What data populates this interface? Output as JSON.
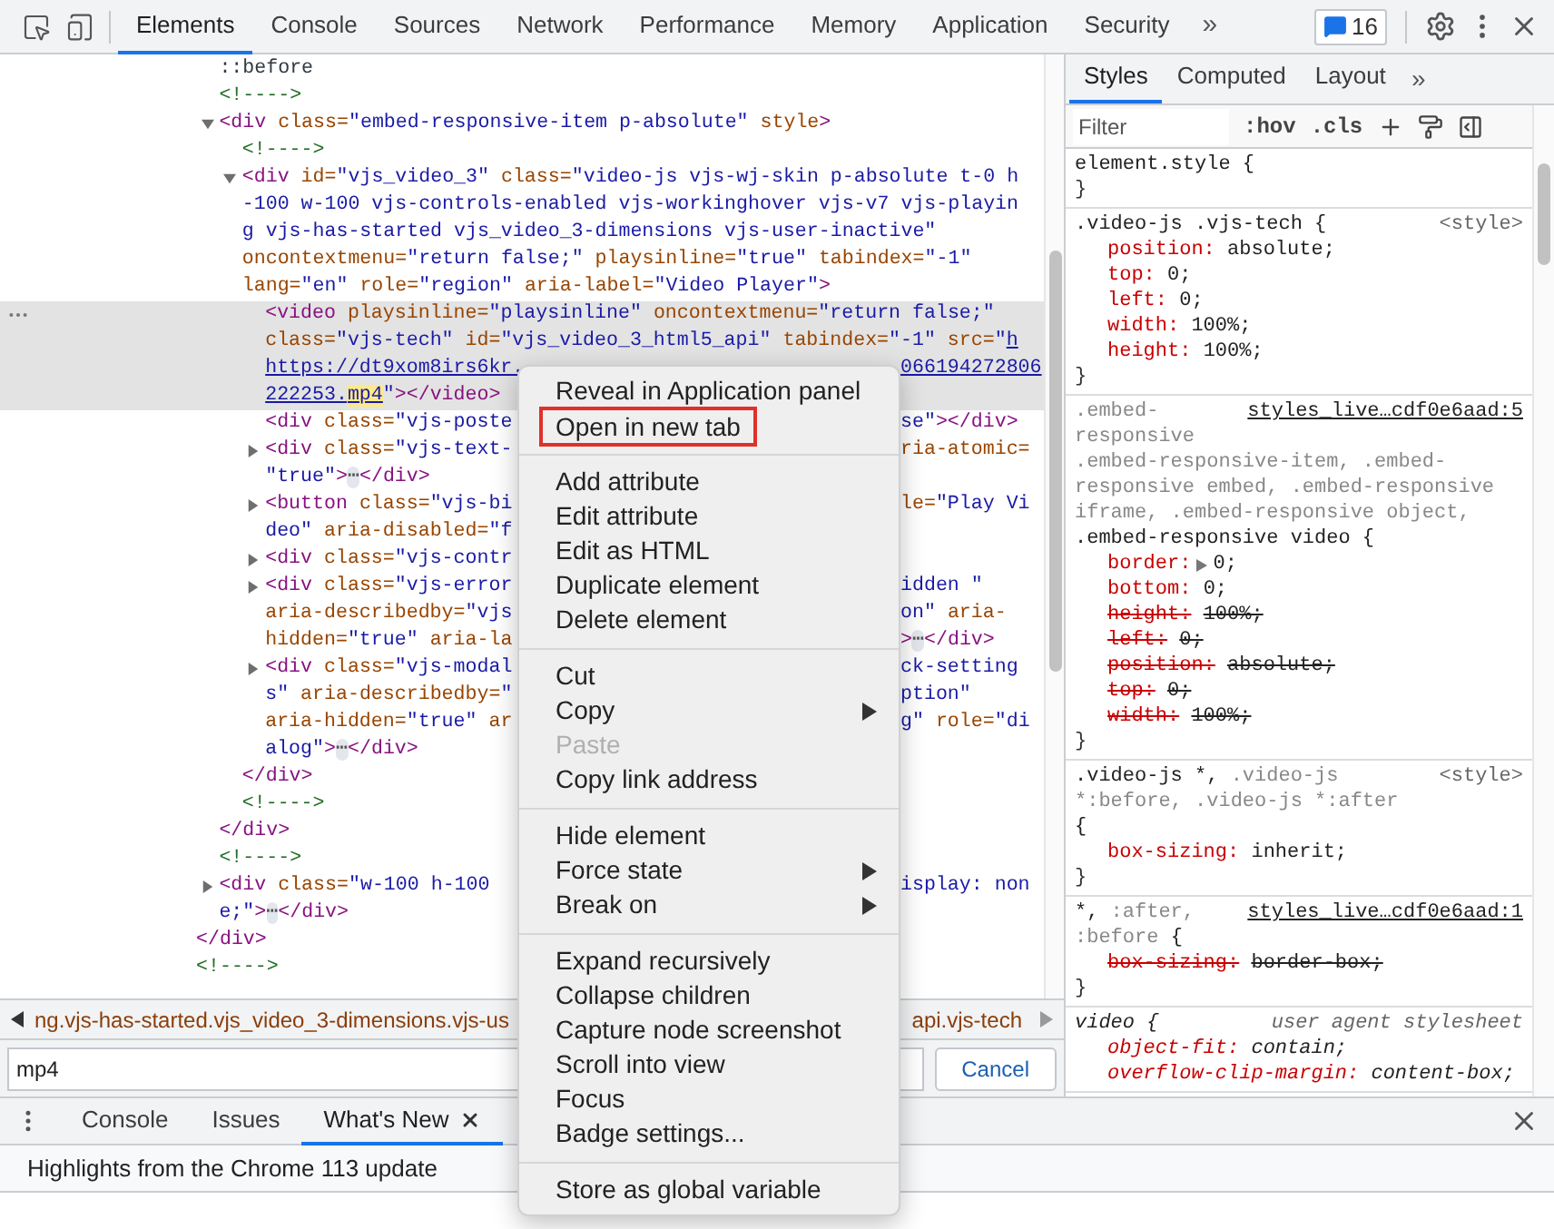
{
  "toolbar": {
    "tabs": [
      {
        "label": "Elements",
        "selected": true
      },
      {
        "label": "Console",
        "selected": false
      },
      {
        "label": "Sources",
        "selected": false
      },
      {
        "label": "Network",
        "selected": false
      },
      {
        "label": "Performance",
        "selected": false
      },
      {
        "label": "Memory",
        "selected": false
      },
      {
        "label": "Application",
        "selected": false
      },
      {
        "label": "Security",
        "selected": false
      }
    ],
    "more": "»",
    "issues_count": "16"
  },
  "elements": {
    "tree": [
      {
        "closing": "</div>",
        "children": [
          {
            "lines": [
              "::before"
            ],
            "selected": false
          },
          {
            "lines": [
              "<!---->"
            ],
            "selected": false
          },
          {
            "lines": [
              "<div class=\"embed-responsive-item p-absolute\" style>"
            ],
            "selected": false,
            "expanded": true,
            "closing": "</div>",
            "children": [
              {
                "lines": [
                  "<!---->"
                ],
                "selected": false
              },
              {
                "lines": [
                  "<div id=\"vjs_video_3\" class=\"video-js vjs-wj-skin p-absolute t-0 h",
                  "-100 w-100 vjs-controls-enabled vjs-workinghover vjs-v7 vjs-playin",
                  "g vjs-has-started vjs_video_3-dimensions vjs-user-inactive\"",
                  "oncontextmenu=\"return false;\" playsinline=\"true\" tabindex=\"-1\"",
                  "lang=\"en\" role=\"region\" aria-label=\"Video Player\">"
                ],
                "selected": false,
                "expanded": true,
                "closing": "</div>",
                "children": [
                  {
                    "lines": [
                      "<video playsinline=\"playsinline\" oncontextmenu=\"return false;\"",
                      {
                        "segments": [
                          {
                            "kind": "attr",
                            "text": "class="
                          },
                          {
                            "kind": "value",
                            "text": "\"vjs-tech\""
                          },
                          {
                            "kind": "attr",
                            "text": " id="
                          },
                          {
                            "kind": "value",
                            "text": "\"vjs_video_3_html5_api\""
                          },
                          {
                            "kind": "attr",
                            "text": " tabindex="
                          },
                          {
                            "kind": "value",
                            "text": "\"-1\""
                          },
                          {
                            "kind": "attr",
                            "text": " src="
                          },
                          {
                            "kind": "value",
                            "text": "\""
                          },
                          {
                            "kind": "link",
                            "text": "h"
                          }
                        ]
                      },
                      {
                        "segments": [
                          {
                            "kind": "link",
                            "text": "https://dt9xom8irs6kr."
                          }
                        ],
                        "right_segments": [
                          {
                            "kind": "link",
                            "text": "066194272806"
                          }
                        ]
                      },
                      {
                        "segments": [
                          {
                            "kind": "link",
                            "text": "222253."
                          },
                          {
                            "kind": "match",
                            "text": "mp4"
                          },
                          {
                            "kind": "value",
                            "text": "\""
                          },
                          {
                            "kind": "tag",
                            "text": "></video>"
                          }
                        ]
                      }
                    ],
                    "selected": true
                  },
                  {
                    "lines": [
                      {
                        "left": "<div class=\"vjs-poste",
                        "right": "se\"></div>",
                        "right_in_value": true
                      }
                    ],
                    "selected": false
                  },
                  {
                    "lines": [
                      {
                        "left": "<div class=\"vjs-text-",
                        "right": "ria-atomic=",
                        "right_in_value": false
                      },
                      "\"true\">⋯</div>"
                    ],
                    "selected": false,
                    "expanded": false
                  },
                  {
                    "lines": [
                      {
                        "left": "<button class=\"vjs-bi",
                        "right": "le=\"Play Vi",
                        "right_in_value": false
                      },
                      "deo\" aria-disabled=\"f"
                    ],
                    "selected": false,
                    "expanded": false
                  },
                  {
                    "lines": [
                      "<div class=\"vjs-contr"
                    ],
                    "selected": false,
                    "expanded": false
                  },
                  {
                    "lines": [
                      {
                        "left": "<div class=\"vjs-error",
                        "right": "idden \"",
                        "right_in_value": true
                      },
                      {
                        "left": "aria-describedby=\"vjs",
                        "right": "on\" aria-",
                        "right_in_value": true
                      },
                      {
                        "left": "hidden=\"true\" aria-la",
                        "right": ">⋯</div>",
                        "right_in_value": false
                      }
                    ],
                    "selected": false,
                    "expanded": false
                  },
                  {
                    "lines": [
                      {
                        "left": "<div class=\"vjs-modal",
                        "right": "ck-setting",
                        "right_in_value": true
                      },
                      {
                        "left": "s\" aria-describedby=\"",
                        "right": "ption\"",
                        "right_in_value": true
                      },
                      {
                        "left": "aria-hidden=\"true\" ar",
                        "right": "g\" role=\"di",
                        "right_in_value": true
                      },
                      "alog\">⋯</div>"
                    ],
                    "selected": false,
                    "expanded": false
                  }
                ]
              },
              {
                "lines": [
                  "<!---->"
                ],
                "selected": false
              }
            ]
          },
          {
            "lines": [
              "<!---->"
            ],
            "selected": false
          },
          {
            "lines": [
              {
                "left": "<div class=\"w-100 h-100 ",
                "right": "isplay: non",
                "right_in_value": true
              },
              "e;\">⋯</div>"
            ],
            "selected": false,
            "expanded": false
          }
        ]
      },
      {
        "lines": [
          "<!---->"
        ],
        "selected": false
      }
    ],
    "breadcrumbs": {
      "left": "ng.vjs-has-started.vjs_video_3-dimensions.vjs-us",
      "right": "api.vjs-tech"
    },
    "search": {
      "value": "mp4",
      "cancel": "Cancel"
    }
  },
  "styles": {
    "tabs": [
      {
        "label": "Styles",
        "selected": true
      },
      {
        "label": "Computed",
        "selected": false
      },
      {
        "label": "Layout",
        "selected": false
      }
    ],
    "more": "»",
    "filter": {
      "placeholder": "Filter"
    },
    "toggles": [
      ":hov",
      ".cls"
    ],
    "rules": [
      {
        "selector": [
          [
            {
              "text": "element.style {",
              "matched": true
            }
          ]
        ],
        "closing": "}"
      },
      {
        "selector": [
          [
            {
              "text": ".video-js .vjs-tech {",
              "matched": true
            }
          ]
        ],
        "source": "<style>",
        "source_link": false,
        "user_agent": false,
        "props": [
          {
            "name": "position:",
            "value": "absolute;",
            "struck": false
          },
          {
            "name": "top:",
            "value": "0;",
            "struck": false
          },
          {
            "name": "left:",
            "value": "0;",
            "struck": false
          },
          {
            "name": "width:",
            "value": "100%;",
            "struck": false
          },
          {
            "name": "height:",
            "value": "100%;",
            "struck": false
          }
        ],
        "closing": "}"
      },
      {
        "selector": [
          [
            {
              "text": ".embed-",
              "matched": false
            }
          ],
          [
            {
              "text": "responsive",
              "matched": false
            }
          ],
          [
            {
              "text": ".embed-responsive-item, .embed-",
              "matched": false
            }
          ],
          [
            {
              "text": "responsive embed, .embed-responsive",
              "matched": false
            }
          ],
          [
            {
              "text": "iframe, .embed-responsive object,",
              "matched": false
            }
          ],
          [
            {
              "text": ".embed-responsive video {",
              "matched": true
            }
          ]
        ],
        "source": "styles_live…cdf0e6aad:5",
        "source_link": true,
        "user_agent": false,
        "props": [
          {
            "name": "border:",
            "value": "0;",
            "struck": false,
            "expandable": true
          },
          {
            "name": "bottom:",
            "value": "0;",
            "struck": false
          },
          {
            "name": "height:",
            "value": "100%;",
            "struck": true
          },
          {
            "name": "left:",
            "value": "0;",
            "struck": true
          },
          {
            "name": "position:",
            "value": "absolute;",
            "struck": true
          },
          {
            "name": "top:",
            "value": "0;",
            "struck": true
          },
          {
            "name": "width:",
            "value": "100%;",
            "struck": true
          }
        ],
        "closing": "}"
      },
      {
        "selector": [
          [
            {
              "text": ".video-js *,",
              "matched": true
            },
            {
              "text": " .video-js",
              "matched": false
            }
          ],
          [
            {
              "text": "*:before, .video-js *:after",
              "matched": false
            }
          ],
          [
            {
              "text": "{",
              "matched": true
            }
          ]
        ],
        "source": "<style>",
        "source_link": false,
        "user_agent": false,
        "props": [
          {
            "name": "box-sizing:",
            "value": "inherit;",
            "struck": false
          }
        ],
        "closing": "}"
      },
      {
        "selector": [
          [
            {
              "text": "*,",
              "matched": true
            },
            {
              "text": " :after,",
              "matched": false
            }
          ],
          [
            {
              "text": ":before",
              "matched": false
            },
            {
              "text": " {",
              "matched": true
            }
          ]
        ],
        "source": "styles_live…cdf0e6aad:1",
        "source_link": true,
        "user_agent": false,
        "props": [
          {
            "name": "box-sizing:",
            "value": "border-box;",
            "struck": true
          }
        ],
        "closing": "}"
      },
      {
        "selector": [
          [
            {
              "text": "video {",
              "matched": true
            }
          ]
        ],
        "source": "user agent stylesheet",
        "source_link": false,
        "user_agent": true,
        "props": [
          {
            "name": "object-fit:",
            "value": "contain;",
            "struck": false
          },
          {
            "name": "overflow-clip-margin:",
            "value": "content-box;",
            "struck": false
          }
        ]
      }
    ]
  },
  "drawer": {
    "tabs": [
      {
        "label": "Console",
        "selected": false,
        "closable": false
      },
      {
        "label": "Issues",
        "selected": false,
        "closable": false
      },
      {
        "label": "What's New",
        "selected": true,
        "closable": true
      }
    ],
    "content": "Highlights from the Chrome 113 update"
  },
  "context_menu": {
    "groups": [
      [
        {
          "label": "Reveal in Application panel",
          "disabled": false,
          "submenu": false,
          "outlined": false
        },
        {
          "label": "Open in new tab",
          "disabled": false,
          "submenu": false,
          "outlined": true
        }
      ],
      [
        {
          "label": "Add attribute",
          "disabled": false,
          "submenu": false,
          "outlined": false
        },
        {
          "label": "Edit attribute",
          "disabled": false,
          "submenu": false,
          "outlined": false
        },
        {
          "label": "Edit as HTML",
          "disabled": false,
          "submenu": false,
          "outlined": false
        },
        {
          "label": "Duplicate element",
          "disabled": false,
          "submenu": false,
          "outlined": false
        },
        {
          "label": "Delete element",
          "disabled": false,
          "submenu": false,
          "outlined": false
        }
      ],
      [
        {
          "label": "Cut",
          "disabled": false,
          "submenu": false,
          "outlined": false
        },
        {
          "label": "Copy",
          "disabled": false,
          "submenu": true,
          "outlined": false
        },
        {
          "label": "Paste",
          "disabled": true,
          "submenu": false,
          "outlined": false
        },
        {
          "label": "Copy link address",
          "disabled": false,
          "submenu": false,
          "outlined": false
        }
      ],
      [
        {
          "label": "Hide element",
          "disabled": false,
          "submenu": false,
          "outlined": false
        },
        {
          "label": "Force state",
          "disabled": false,
          "submenu": true,
          "outlined": false
        },
        {
          "label": "Break on",
          "disabled": false,
          "submenu": true,
          "outlined": false
        }
      ],
      [
        {
          "label": "Expand recursively",
          "disabled": false,
          "submenu": false,
          "outlined": false
        },
        {
          "label": "Collapse children",
          "disabled": false,
          "submenu": false,
          "outlined": false
        },
        {
          "label": "Capture node screenshot",
          "disabled": false,
          "submenu": false,
          "outlined": false
        },
        {
          "label": "Scroll into view",
          "disabled": false,
          "submenu": false,
          "outlined": false
        },
        {
          "label": "Focus",
          "disabled": false,
          "submenu": false,
          "outlined": false
        },
        {
          "label": "Badge settings...",
          "disabled": false,
          "submenu": false,
          "outlined": false
        }
      ],
      [
        {
          "label": "Store as global variable",
          "disabled": false,
          "submenu": false,
          "outlined": false
        }
      ]
    ]
  }
}
